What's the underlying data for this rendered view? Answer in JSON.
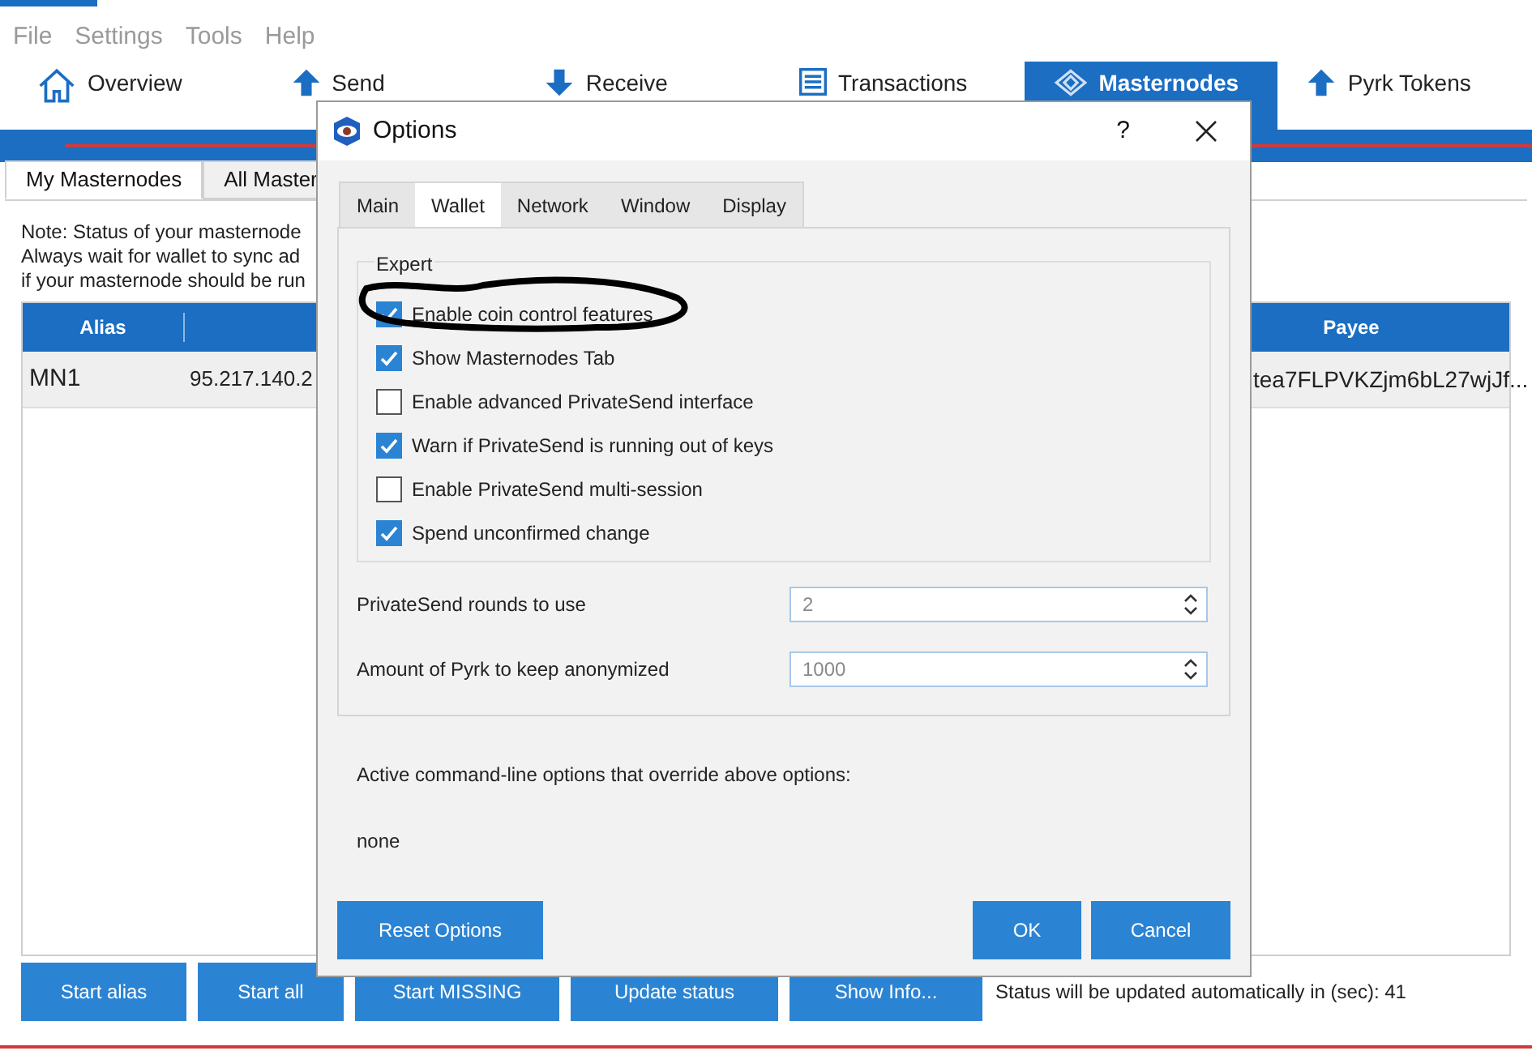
{
  "menu": [
    "File",
    "Settings",
    "Tools",
    "Help"
  ],
  "nav_tabs": [
    {
      "label": "Overview",
      "selected": false
    },
    {
      "label": "Send",
      "selected": false
    },
    {
      "label": "Receive",
      "selected": false
    },
    {
      "label": "Transactions",
      "selected": false
    },
    {
      "label": "Masternodes",
      "selected": true
    },
    {
      "label": "Pyrk Tokens",
      "selected": false
    }
  ],
  "sub_tabs": [
    {
      "label": "My Masternodes",
      "selected": true
    },
    {
      "label": "All Master",
      "selected": false
    }
  ],
  "note_lines": [
    "Note: Status of your masternode",
    "Always wait for wallet to sync ad",
    "if your masternode should be run"
  ],
  "table": {
    "columns": [
      "Alias",
      "Payee"
    ],
    "rows": [
      {
        "alias": "MN1",
        "column_2": "95.217.140.2",
        "payee": "tea7FLPVKZjm6bL27wjJf..."
      }
    ]
  },
  "bottom_buttons": [
    "Start alias",
    "Start all",
    "Start MISSING",
    "Update status",
    "Show Info..."
  ],
  "status_text": "Status will be updated automatically in (sec):  41",
  "dialog": {
    "title": "Options",
    "help": "?",
    "tabs": [
      {
        "label": "Main",
        "selected": false
      },
      {
        "label": "Wallet",
        "selected": true
      },
      {
        "label": "Network",
        "selected": false
      },
      {
        "label": "Window",
        "selected": false
      },
      {
        "label": "Display",
        "selected": false
      }
    ],
    "group_title": "Expert",
    "checkboxes": [
      {
        "label": "Enable coin control features",
        "checked": true
      },
      {
        "label": "Show Masternodes Tab",
        "checked": true
      },
      {
        "label": "Enable advanced PrivateSend interface",
        "checked": false
      },
      {
        "label": "Warn if PrivateSend is running out of keys",
        "checked": true
      },
      {
        "label": "Enable PrivateSend multi-session",
        "checked": false
      },
      {
        "label": "Spend unconfirmed change",
        "checked": true
      }
    ],
    "spinboxes": [
      {
        "label": "PrivateSend rounds to use",
        "value": "2"
      },
      {
        "label": "Amount of Pyrk to keep anonymized",
        "value": "1000"
      }
    ],
    "override_label": "Active command-line options that override above options:",
    "override_value": "none",
    "buttons": {
      "reset": "Reset Options",
      "ok": "OK",
      "cancel": "Cancel"
    }
  }
}
